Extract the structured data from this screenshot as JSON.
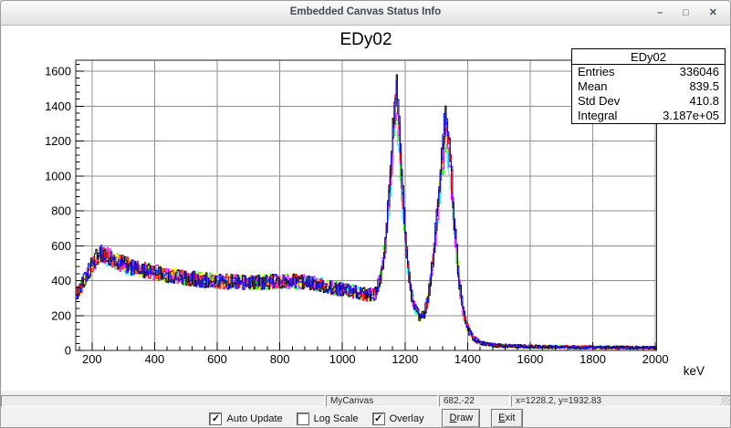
{
  "window": {
    "title": "Embedded Canvas Status Info",
    "buttons": {
      "minimize": "–",
      "maximize": "□",
      "close": "✕"
    }
  },
  "canvas_title": "EDy02",
  "stats_box": {
    "title": "EDy02",
    "rows": [
      {
        "label": "Entries",
        "value": "336046"
      },
      {
        "label": "Mean",
        "value": "839.5"
      },
      {
        "label": "Std Dev",
        "value": "410.8"
      },
      {
        "label": "Integral",
        "value": "3.187e+05"
      }
    ]
  },
  "status_bar": {
    "segments": [
      "",
      "MyCanvas",
      "682,-22",
      "x=1228.2, y=1932.83"
    ]
  },
  "controls": {
    "check_glyph": "✓",
    "checkboxes": [
      {
        "label": "Auto Update",
        "checked": true
      },
      {
        "label": "Log Scale",
        "checked": false
      },
      {
        "label": "Overlay",
        "checked": true
      }
    ],
    "buttons": [
      {
        "label": "Draw",
        "underline_first": true
      },
      {
        "label": "Exit",
        "underline_first": true
      }
    ]
  },
  "chart_data": {
    "type": "line",
    "title": "EDy02",
    "xlabel": "keV",
    "ylabel": "",
    "xlim": [
      148,
      2004
    ],
    "ylim": [
      0,
      1663
    ],
    "x_ticks": [
      200,
      400,
      600,
      800,
      1000,
      1200,
      1400,
      1600,
      1800,
      2000
    ],
    "y_ticks": [
      0,
      200,
      400,
      600,
      800,
      1000,
      1200,
      1400,
      1600
    ],
    "minor_step_x": 40,
    "minor_step_y": 40,
    "grid": true,
    "grid_color": "#8f8f8f",
    "frame_color": "#222222",
    "bin_kev": 4,
    "noise_amp": 2.2,
    "anchors": {
      "x": [
        148,
        165,
        180,
        200,
        215,
        232,
        250,
        270,
        300,
        350,
        400,
        450,
        500,
        550,
        600,
        650,
        700,
        750,
        800,
        850,
        880,
        920,
        950,
        1000,
        1050,
        1080,
        1105,
        1125,
        1140,
        1155,
        1165,
        1173,
        1181,
        1192,
        1205,
        1220,
        1235,
        1250,
        1262,
        1275,
        1290,
        1305,
        1318,
        1332,
        1345,
        1358,
        1372,
        1385,
        1398,
        1412,
        1430,
        1455,
        1490,
        1550,
        1650,
        1800,
        2000
      ],
      "y": [
        320,
        365,
        430,
        490,
        535,
        555,
        545,
        525,
        495,
        465,
        448,
        430,
        418,
        405,
        398,
        392,
        390,
        392,
        394,
        396,
        392,
        380,
        368,
        348,
        330,
        318,
        325,
        430,
        650,
        1050,
        1380,
        1560,
        1380,
        950,
        560,
        330,
        225,
        192,
        215,
        310,
        520,
        820,
        1150,
        1390,
        1150,
        750,
        420,
        240,
        140,
        85,
        55,
        38,
        28,
        24,
        20,
        18,
        15
      ]
    },
    "peaks_kev": [
      1173,
      1332
    ],
    "series": [
      {
        "name": "spectrum-green",
        "color": "#00ff00",
        "peak_scale": 0.88,
        "seed": 11
      },
      {
        "name": "spectrum-cyan",
        "color": "#00ffff",
        "peak_scale": 0.86,
        "seed": 22
      },
      {
        "name": "spectrum-yellow",
        "color": "#ffff00",
        "peak_scale": 0.93,
        "seed": 33
      },
      {
        "name": "spectrum-magenta",
        "color": "#ff00ff",
        "peak_scale": 0.91,
        "seed": 44
      },
      {
        "name": "spectrum-red",
        "color": "#ff0000",
        "peak_scale": 0.96,
        "seed": 55
      },
      {
        "name": "spectrum-black",
        "color": "#000000",
        "peak_scale": 0.98,
        "seed": 66
      },
      {
        "name": "spectrum-blue",
        "color": "#0000ff",
        "peak_scale": 1.0,
        "seed": 77
      }
    ]
  }
}
